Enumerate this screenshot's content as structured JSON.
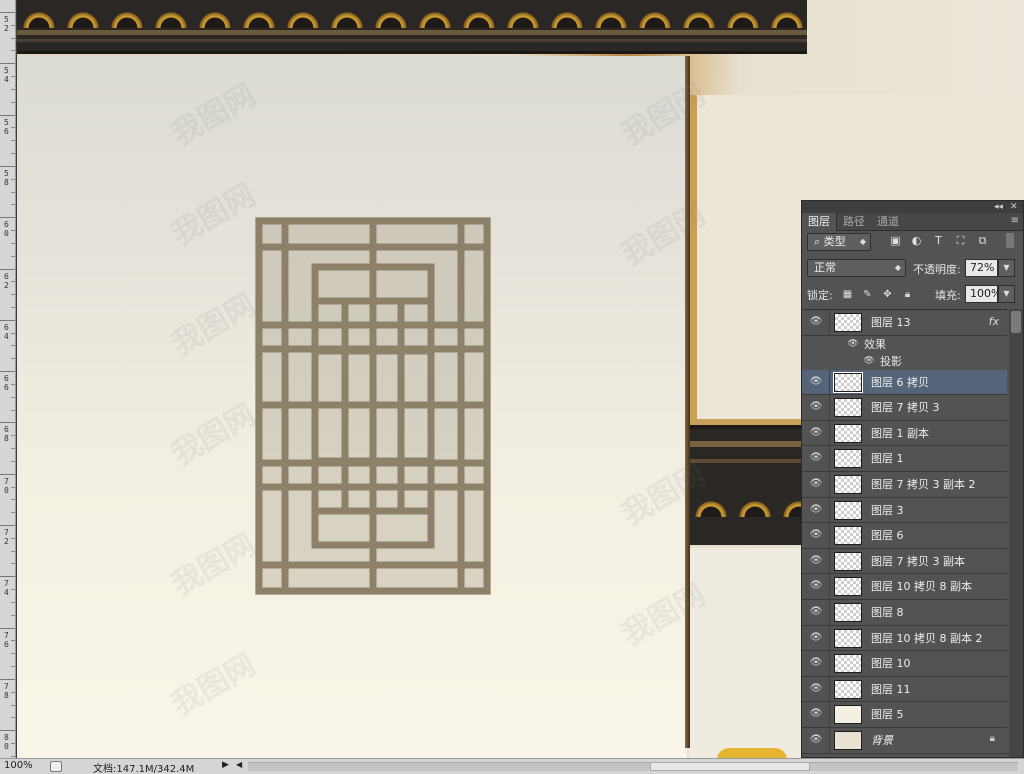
{
  "ruler": {
    "labels": [
      "52",
      "54",
      "56",
      "58",
      "60",
      "62",
      "64",
      "66",
      "68",
      "70",
      "72",
      "74",
      "76",
      "78",
      "80"
    ]
  },
  "canvas": {
    "watermark_text": "我图网"
  },
  "status_bar": {
    "zoom": "100%",
    "doc_info": "文档:147.1M/342.4M",
    "arrow": "▶",
    "scroll_left": "◀"
  },
  "layers_panel": {
    "collapse_glyph": "◂◂",
    "close_glyph": "✕",
    "tabs": [
      {
        "label": "图层",
        "active": true
      },
      {
        "label": "路径",
        "active": false
      },
      {
        "label": "通道",
        "active": false
      }
    ],
    "menu_glyph": "≡",
    "filter_kind": "类型",
    "blend_mode": "正常",
    "opacity_label": "不透明度:",
    "opacity_value": "72%",
    "lock_label": "锁定:",
    "fill_label": "填充:",
    "fill_value": "100%",
    "layers": [
      {
        "name": "图层 13",
        "fx": "fx",
        "thumb": "transparent",
        "selected": false
      },
      {
        "name": "图层 6 拷贝",
        "thumb": "transparent",
        "selected": true
      },
      {
        "name": "图层 7 拷贝 3",
        "thumb": "transparent",
        "selected": false
      },
      {
        "name": "图层 1 副本",
        "thumb": "transparent",
        "selected": false
      },
      {
        "name": "图层 1",
        "thumb": "transparent",
        "selected": false
      },
      {
        "name": "图层 7 拷贝 3 副本 2",
        "thumb": "transparent",
        "selected": false
      },
      {
        "name": "图层 3",
        "thumb": "transparent",
        "selected": false
      },
      {
        "name": "图层 6",
        "thumb": "transparent",
        "selected": false
      },
      {
        "name": "图层 7 拷贝 3 副本",
        "thumb": "transparent",
        "selected": false
      },
      {
        "name": "图层 10 拷贝 8 副本",
        "thumb": "transparent",
        "selected": false
      },
      {
        "name": "图层 8",
        "thumb": "transparent",
        "selected": false
      },
      {
        "name": "图层 10 拷贝 8 副本 2",
        "thumb": "transparent",
        "selected": false
      },
      {
        "name": "图层 10",
        "thumb": "transparent",
        "selected": false
      },
      {
        "name": "图层 11",
        "thumb": "transparent",
        "selected": false
      },
      {
        "name": "图层 5",
        "thumb": "cream",
        "selected": false
      },
      {
        "name": "背景",
        "thumb": "bg",
        "selected": false,
        "locked": true
      }
    ],
    "effects_label": "效果",
    "drop_shadow_label": "投影"
  },
  "colors": {
    "panel_bg": "#535353",
    "selected_layer": "#56647a",
    "lattice": "#8a7f66",
    "roof_gold": "#d9a633"
  },
  "icons": {
    "eye": "visibility-eye-icon",
    "lock": "lock-icon",
    "search": "search-icon"
  }
}
